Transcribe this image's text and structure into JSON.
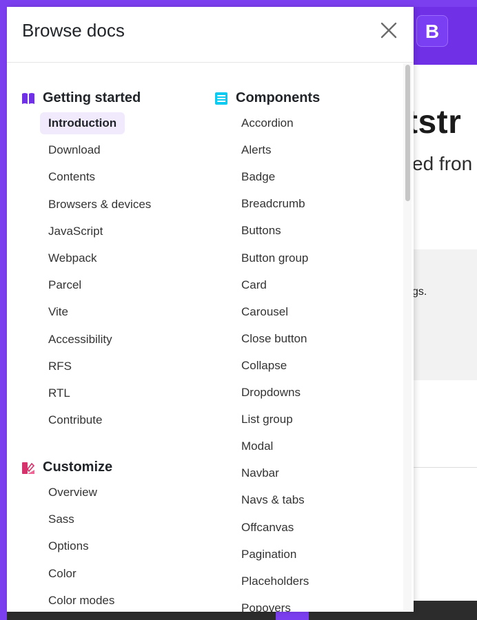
{
  "background": {
    "logo_letter": "B",
    "hero_fragment": "tstr",
    "subtitle_fragment": "ed fron",
    "snippet_fragment": "gs."
  },
  "offcanvas": {
    "title": "Browse docs",
    "close_icon": "close-icon",
    "sections": {
      "getting_started": {
        "title": "Getting started",
        "icon": "book-icon",
        "icon_color": "#6f30e6",
        "items": [
          "Introduction",
          "Download",
          "Contents",
          "Browsers & devices",
          "JavaScript",
          "Webpack",
          "Parcel",
          "Vite",
          "Accessibility",
          "RFS",
          "RTL",
          "Contribute"
        ],
        "active": "Introduction"
      },
      "customize": {
        "title": "Customize",
        "icon": "palette-icon",
        "icon_color": "#d6336c",
        "items": [
          "Overview",
          "Sass",
          "Options",
          "Color",
          "Color modes"
        ]
      },
      "components": {
        "title": "Components",
        "icon": "components-icon",
        "icon_color": "#0dcaf0",
        "items": [
          "Accordion",
          "Alerts",
          "Badge",
          "Breadcrumb",
          "Buttons",
          "Button group",
          "Card",
          "Carousel",
          "Close button",
          "Collapse",
          "Dropdowns",
          "List group",
          "Modal",
          "Navbar",
          "Navs & tabs",
          "Offcanvas",
          "Pagination",
          "Placeholders",
          "Popovers"
        ]
      }
    }
  }
}
